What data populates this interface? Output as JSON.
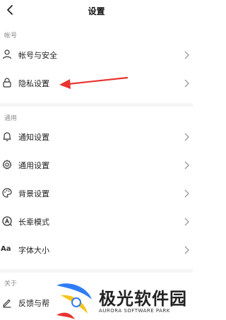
{
  "header": {
    "title": "设置"
  },
  "sections": [
    {
      "label": "帐号"
    },
    {
      "label": "通用"
    },
    {
      "label": "关于"
    }
  ],
  "rows": [
    {
      "label": "帐号与安全",
      "icon": "person-icon"
    },
    {
      "label": "隐私设置",
      "icon": "lock-icon"
    },
    {
      "label": "通知设置",
      "icon": "bell-icon"
    },
    {
      "label": "通用设置",
      "icon": "gear-icon"
    },
    {
      "label": "背景设置",
      "icon": "palette-icon"
    },
    {
      "label": "长辈模式",
      "icon": "elder-mode-icon"
    },
    {
      "label": "字体大小",
      "icon": "font-size-icon",
      "icon_text": "Aa"
    },
    {
      "label": "反馈与帮",
      "icon": "edit-icon"
    }
  ],
  "watermark": {
    "title": "极光软件园",
    "subtitle": "AURORA SOFTWARE PARK"
  },
  "colors": {
    "annotation_arrow": "#e8342f",
    "logo_blue": "#2f7cf6",
    "logo_yellow": "#f7c41a",
    "logo_red": "#e8342f"
  }
}
